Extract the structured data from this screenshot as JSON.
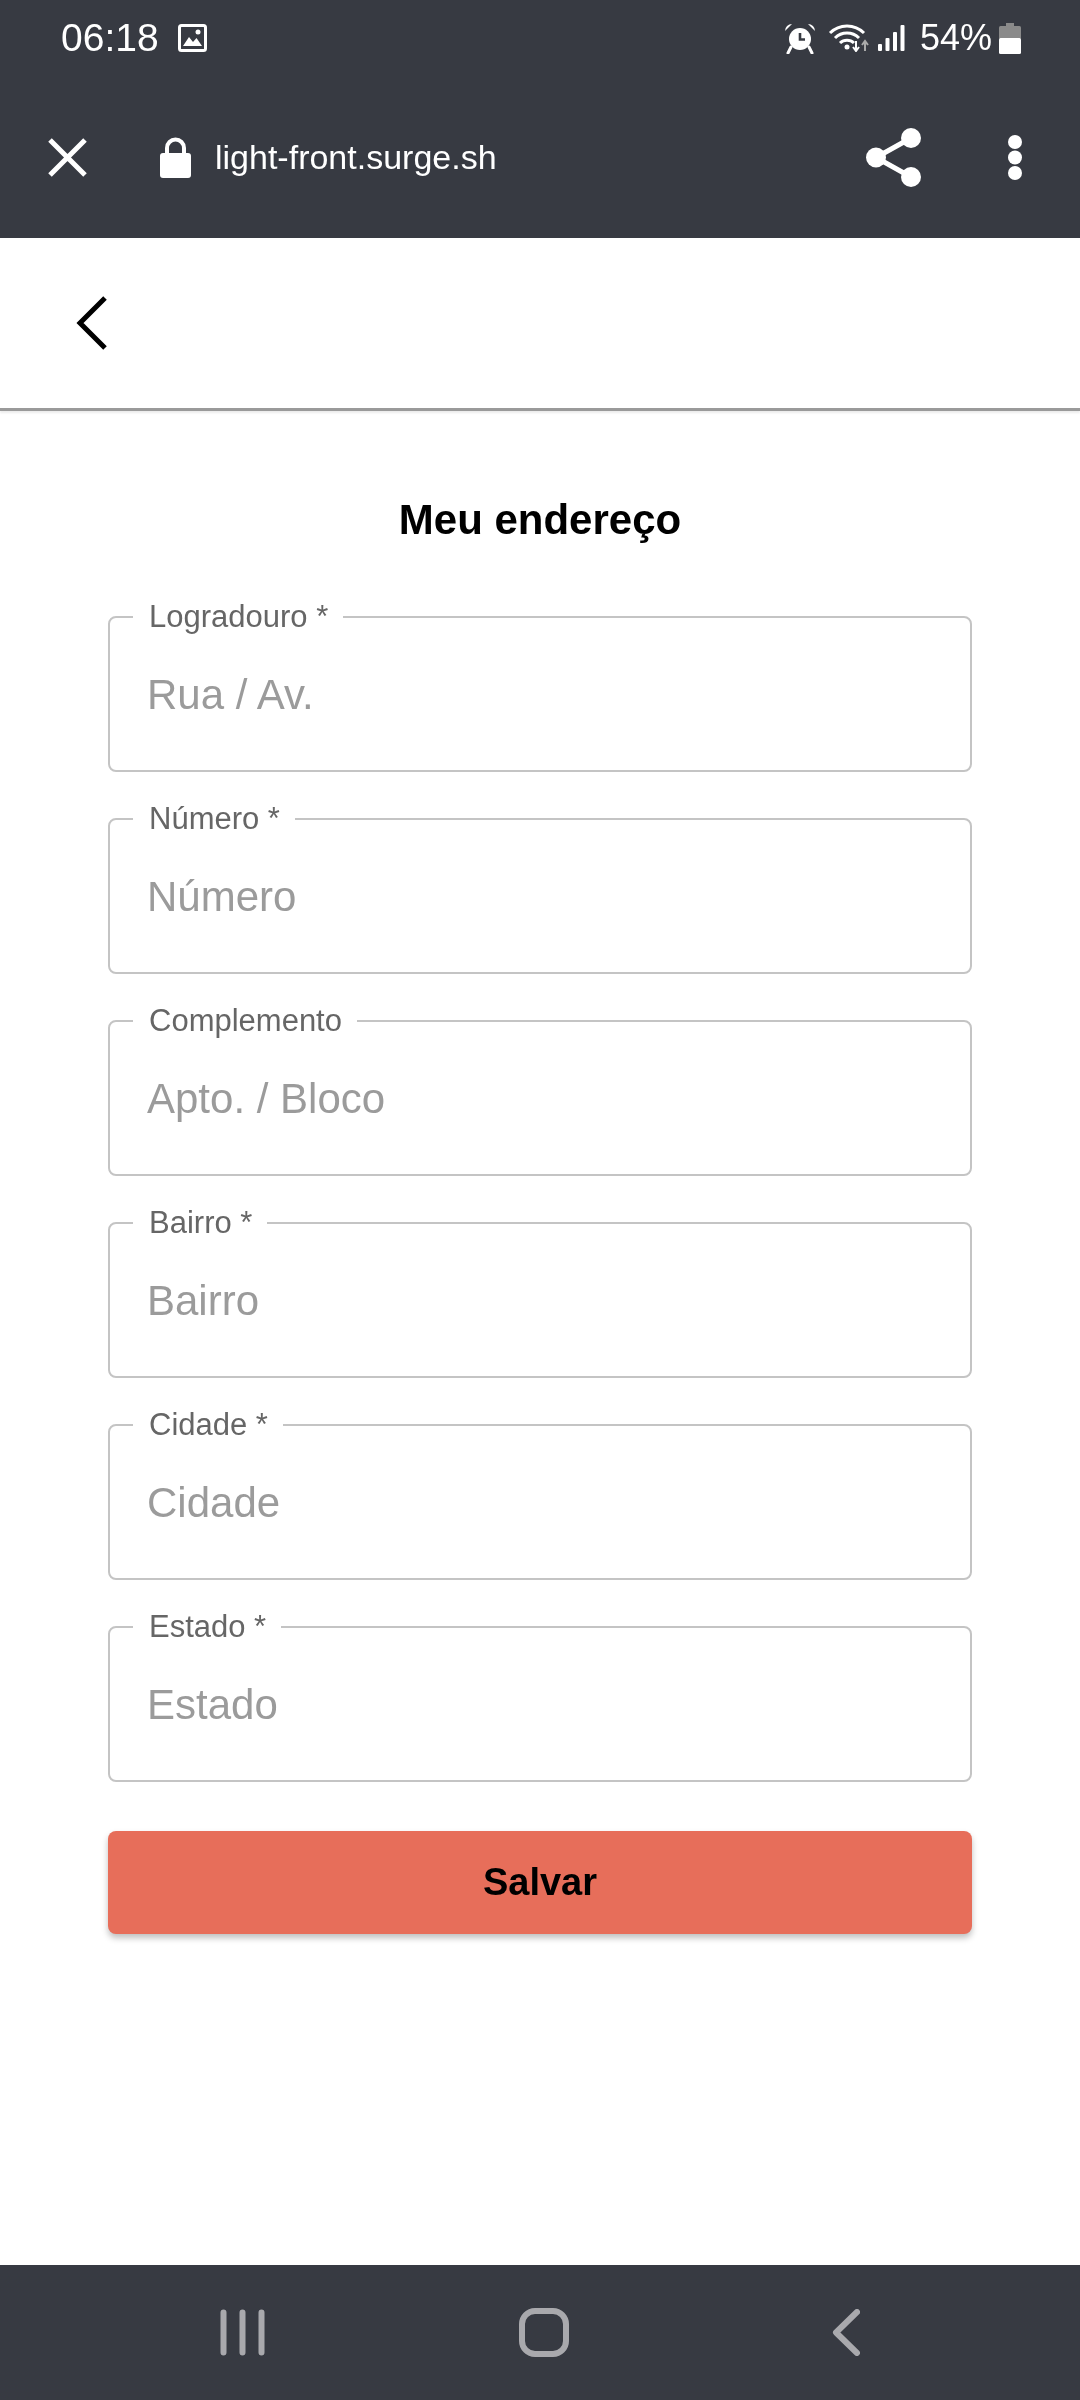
{
  "status_bar": {
    "time": "06:18",
    "battery": "54%"
  },
  "browser_bar": {
    "url": "light-front.surge.sh"
  },
  "page": {
    "title": "Meu endereço"
  },
  "form": {
    "fields": [
      {
        "label": "Logradouro *",
        "placeholder": "Rua / Av."
      },
      {
        "label": "Número *",
        "placeholder": "Número"
      },
      {
        "label": "Complemento",
        "placeholder": "Apto. / Bloco"
      },
      {
        "label": "Bairro *",
        "placeholder": "Bairro"
      },
      {
        "label": "Cidade *",
        "placeholder": "Cidade"
      },
      {
        "label": "Estado *",
        "placeholder": "Estado"
      }
    ],
    "submit": "Salvar"
  }
}
